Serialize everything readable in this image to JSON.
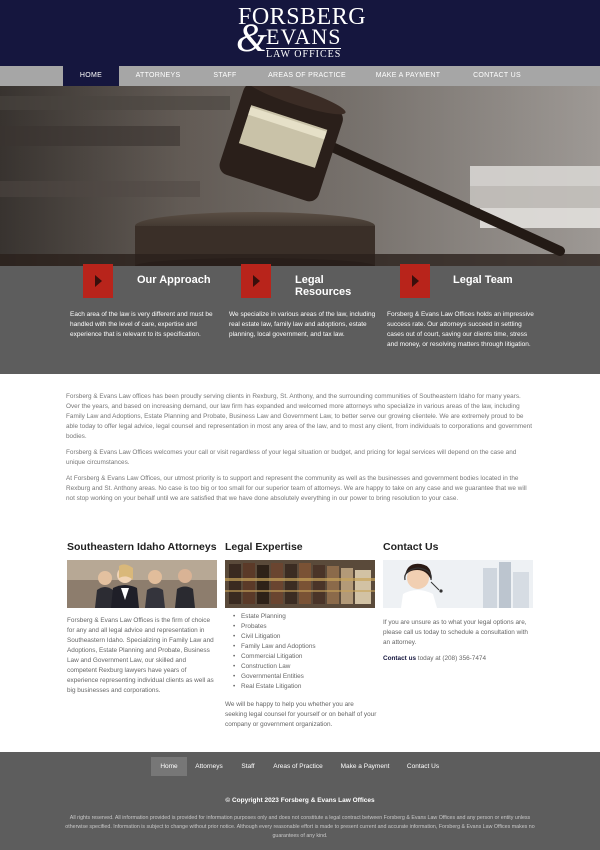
{
  "logo": {
    "line1": "FORSBERG",
    "ampersand": "&",
    "line2": "EVANS",
    "line3": "LAW OFFICES"
  },
  "nav": {
    "items": [
      {
        "label": "HOME",
        "active": true
      },
      {
        "label": "ATTORNEYS",
        "active": false
      },
      {
        "label": "STAFF",
        "active": false
      },
      {
        "label": "AREAS OF PRACTICE",
        "active": false
      },
      {
        "label": "MAKE A PAYMENT",
        "active": false
      },
      {
        "label": "CONTACT US",
        "active": false
      }
    ]
  },
  "features": [
    {
      "title": "Our Approach",
      "text": "Each area of the law is very different and must be handled with the level of care, expertise and experience that is relevant to its specification."
    },
    {
      "title_line1": "Legal",
      "title_line2": "Resources",
      "text": "We specialize in various areas of the law, including real estate law, family law and adoptions, estate planning, local government, and tax law."
    },
    {
      "title": "Legal Team",
      "text": "Forsberg & Evans Law Offices holds an impressive success rate. Our attorneys succeed in settling cases out of court, saving our clients time, stress and money, or resolving matters through litigation."
    }
  ],
  "intro": {
    "p1": "Forsberg & Evans Law offices has been proudly serving clients in Rexburg, St. Anthony, and the surrounding communities of Southeastern Idaho for many years. Over the years, and based on increasing demand, our law firm has expanded and welcomed more attorneys who specialize in various areas of the law, including Family Law and Adoptions, Estate Planning and Probate, Business Law and Government Law, to better serve our growing clientele. We are extremely proud to be able today to offer legal advice, legal counsel and representation in most any area of the law, and to most any client, from individuals to corporations and government bodies.",
    "p2": "Forsberg & Evans Law Offices welcomes your call or visit regardless of your legal situation or budget, and pricing for legal services will depend on the case and unique circumstances.",
    "p3": "At Forsberg & Evans Law Offices, our utmost priority is to support and represent the community as well as the businesses and government bodies located in the Rexburg and St. Anthony areas. No case is too big or too small for our superior team of attorneys. We are happy to take on any case and we guarantee that we will not stop working on your behalf until we are satisfied that we have done absolutely everything in our power to bring resolution to your case."
  },
  "columns": {
    "attorneys": {
      "title": "Southeastern Idaho Attorneys",
      "text": "Forsberg & Evans Law Offices is the firm of choice for any and all legal advice and representation in Southeastern Idaho. Specializing in Family Law and Adoptions, Estate Planning and Probate, Business Law and Government Law, our skilled and competent Rexburg lawyers have years of experience representing individual clients as well as big businesses and corporations."
    },
    "expertise": {
      "title": "Legal Expertise",
      "items": [
        "Estate Planning",
        "Probates",
        "Civil Litigation",
        "Family Law and Adoptions",
        "Commercial Litigation",
        "Construction Law",
        "Governmental Entities",
        "Real Estate Litigation"
      ],
      "text": "We will be happy to help you whether you are seeking legal counsel for yourself or on behalf of your company or government organization."
    },
    "contact": {
      "title": "Contact Us",
      "text": "If you are unsure as to what your legal options are, please call us today to schedule a consultation with an attorney.",
      "link": "Contact us",
      "phone_text": " today at (208) 356-7474"
    }
  },
  "footer": {
    "nav": [
      {
        "label": "Home",
        "active": true
      },
      {
        "label": "Attorneys",
        "active": false
      },
      {
        "label": "Staff",
        "active": false
      },
      {
        "label": "Areas of Practice",
        "active": false
      },
      {
        "label": "Make a Payment",
        "active": false
      },
      {
        "label": "Contact Us",
        "active": false
      }
    ],
    "copyright": "© Copyright 2023 Forsberg & Evans Law Offices",
    "disclaimer": "All rights reserved. All information provided is provided for information purposes only and does not constitute a legal contract between Forsberg & Evans Law Offices and any person or entity unless otherwise specified. Information is subject to change without prior notice. Although every reasonable effort is made to present current and accurate information, Forsberg & Evans Law Offices makes no guarantees of any kind."
  },
  "colors": {
    "brand_navy": "#15163e",
    "nav_gray": "#a6a6a6",
    "panel_gray": "#5d5d5d",
    "accent_red": "#b8241b"
  },
  "icons": {
    "feature_icon": "chevron-right-icon"
  }
}
